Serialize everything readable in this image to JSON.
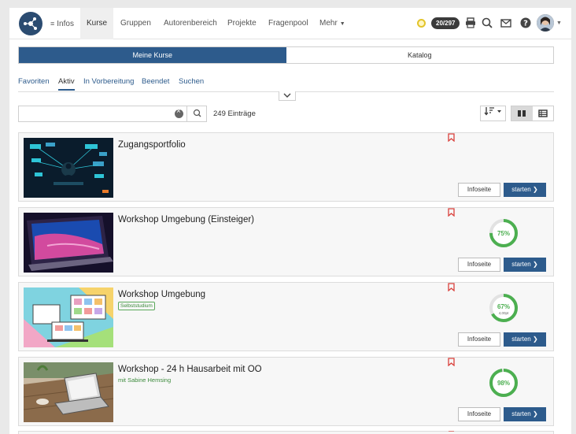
{
  "nav": {
    "items": [
      {
        "label": "Infos",
        "active": false,
        "has_menu_icon": true
      },
      {
        "label": "Kurse",
        "active": true
      },
      {
        "label": "Gruppen",
        "active": false
      },
      {
        "label": "Autorenbereich",
        "active": false
      },
      {
        "label": "Projekte",
        "active": false
      },
      {
        "label": "Fragenpool",
        "active": false
      },
      {
        "label": "Mehr",
        "active": false,
        "dropdown": true
      }
    ],
    "badge": "20/297",
    "icons": [
      "coin-icon",
      "print-icon",
      "search-icon",
      "mail-icon",
      "help-icon",
      "avatar"
    ]
  },
  "segmented": {
    "my_courses": "Meine Kurse",
    "catalog": "Katalog"
  },
  "subtabs": [
    "Favoriten",
    "Aktiv",
    "In Vorbereitung",
    "Beendet",
    "Suchen"
  ],
  "active_subtab": "Aktiv",
  "search": {
    "value": "",
    "placeholder": "",
    "count": "249 Einträge"
  },
  "colors": {
    "primary": "#2d5b8c",
    "success": "#4caf50",
    "bookmark": "#d9413c",
    "tag_green": "#3d8b3d"
  },
  "courses": [
    {
      "title": "Zugangsportfolio",
      "subtitle": "",
      "tag": "",
      "progress_percent": null,
      "progress_extra": "",
      "info_label": "Infoseite",
      "start_label": "starten"
    },
    {
      "title": "Workshop Umgebung (Einsteiger)",
      "subtitle": "",
      "tag": "",
      "progress_percent": 75,
      "progress_text": "75%",
      "progress_extra": "",
      "info_label": "Infoseite",
      "start_label": "starten"
    },
    {
      "title": "Workshop Umgebung",
      "subtitle": "",
      "tag": "Selbststudium",
      "progress_percent": 67,
      "progress_text": "67%",
      "progress_extra": "4,00pt",
      "info_label": "Infoseite",
      "start_label": "starten"
    },
    {
      "title": "Workshop - 24 h Hausarbeit mit OO",
      "subtitle": "mit Sabine Hemsing",
      "tag": "",
      "progress_percent": 98,
      "progress_text": "98%",
      "progress_extra": "",
      "info_label": "Infoseite",
      "start_label": "starten"
    }
  ]
}
